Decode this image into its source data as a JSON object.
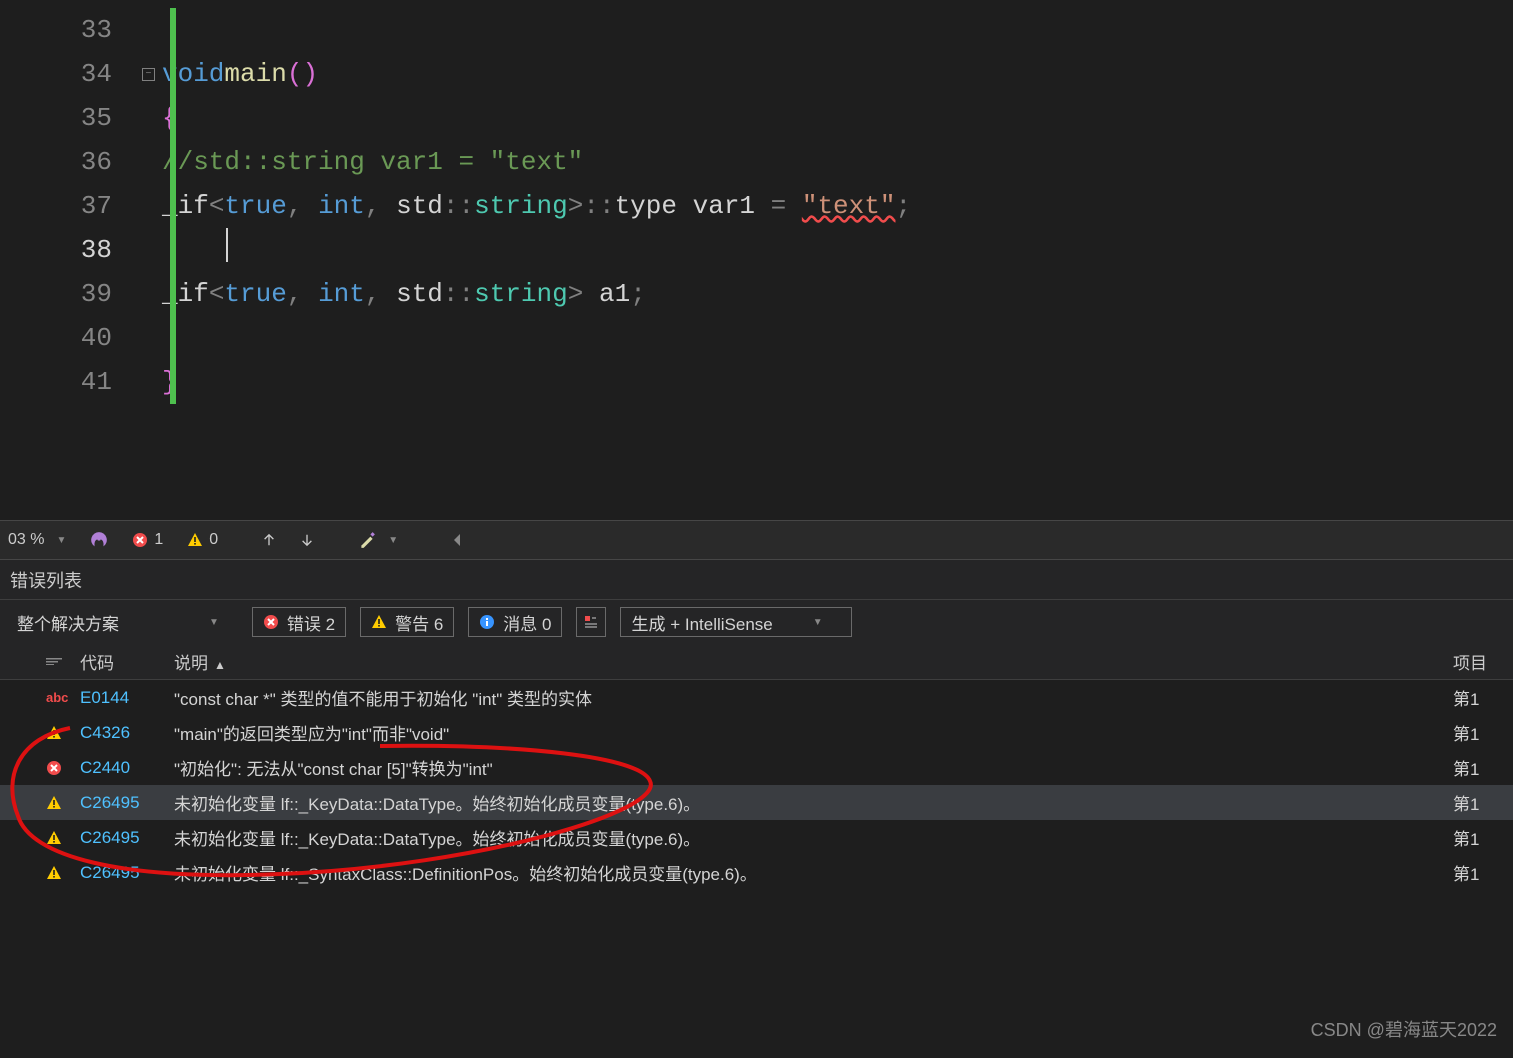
{
  "editor": {
    "lines": [
      {
        "num": "33"
      },
      {
        "num": "34"
      },
      {
        "num": "35"
      },
      {
        "num": "36"
      },
      {
        "num": "37"
      },
      {
        "num": "38"
      },
      {
        "num": "39"
      },
      {
        "num": "40"
      },
      {
        "num": "41"
      }
    ],
    "tokens": {
      "l34_void": "void",
      "l34_main": "main",
      "l34_paren": "()",
      "l35_brace": "{",
      "l36_comment": "//std::string var1 = \"text\"",
      "l37_if": "_if",
      "l37_lt": "<",
      "l37_true": "true",
      "l37_c1": ", ",
      "l37_int": "int",
      "l37_c2": ", ",
      "l37_std": "std",
      "l37_cc": "::",
      "l37_string": "string",
      "l37_gt": ">",
      "l37_cc2": "::",
      "l37_type": "type",
      "l37_sp": " ",
      "l37_var": "var1",
      "l37_eq": " = ",
      "l37_str": "\"text\"",
      "l37_semi": ";",
      "l39_if": "_if",
      "l39_lt": "<",
      "l39_true": "true",
      "l39_c1": ", ",
      "l39_int": "int",
      "l39_c2": ", ",
      "l39_std": "std",
      "l39_cc": "::",
      "l39_string": "string",
      "l39_gt": ">",
      "l39_sp": " ",
      "l39_a1": "a1",
      "l39_semi": ";",
      "l41_brace": "}"
    }
  },
  "status": {
    "zoom": "03 %",
    "errors": "1",
    "warnings": "0"
  },
  "errorPanel": {
    "title": "错误列表",
    "scope": "整个解决方案",
    "errorToggle": "错误 2",
    "warnToggle": "警告 6",
    "infoToggle": "消息 0",
    "buildCombo": "生成 + IntelliSense",
    "columns": {
      "code": "代码",
      "desc": "说明",
      "proj": "项目"
    },
    "rows": [
      {
        "icon": "abc",
        "code": "E0144",
        "desc": "\"const char *\" 类型的值不能用于初始化 \"int\" 类型的实体",
        "proj": "第1"
      },
      {
        "icon": "warn",
        "code": "C4326",
        "desc": "\"main\"的返回类型应为\"int\"而非\"void\"",
        "proj": "第1"
      },
      {
        "icon": "error",
        "code": "C2440",
        "desc": "\"初始化\": 无法从\"const char [5]\"转换为\"int\"",
        "proj": "第1"
      },
      {
        "icon": "warn",
        "code": "C26495",
        "desc": "未初始化变量 lf::_KeyData::DataType。始终初始化成员变量(type.6)。",
        "proj": "第1"
      },
      {
        "icon": "warn",
        "code": "C26495",
        "desc": "未初始化变量 lf::_KeyData::DataType。始终初始化成员变量(type.6)。",
        "proj": "第1"
      },
      {
        "icon": "warn",
        "code": "C26495",
        "desc": "未初始化变量 lf::_SyntaxClass::DefinitionPos。始终初始化成员变量(type.6)。",
        "proj": "第1"
      }
    ]
  },
  "watermark": "CSDN @碧海蓝天2022"
}
